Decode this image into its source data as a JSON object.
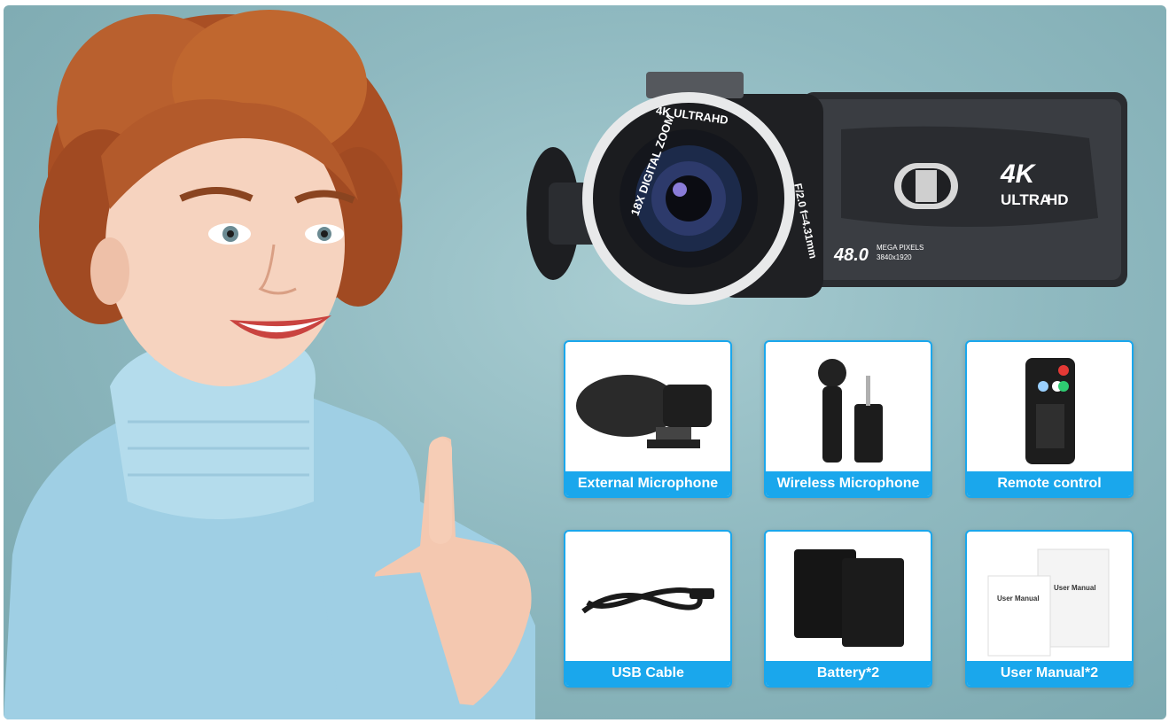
{
  "camera": {
    "lens_ring_text_top": "4K ULTRAHD",
    "lens_ring_text_left": "18X DIGITAL ZOOM",
    "lens_ring_text_right": "F/2.0 f=4.31mm",
    "badge_4k": "4K",
    "badge_ultra": "ULTRA",
    "badge_hd": "HD",
    "megapixel_value": "48.0",
    "megapixel_label": "MEGA PIXELS",
    "resolution": "3840x1920"
  },
  "accessories": [
    {
      "label": "External Microphone"
    },
    {
      "label": "Wireless Microphone"
    },
    {
      "label": "Remote control"
    },
    {
      "label": "USB Cable"
    },
    {
      "label": "Battery*2"
    },
    {
      "label": "User Manual*2"
    }
  ],
  "manual_text": "User Manual",
  "colors": {
    "accent": "#1aa7ec",
    "background": "#8fb9c0",
    "sweater": "#a8d3e6",
    "hair": "#b5592b"
  }
}
